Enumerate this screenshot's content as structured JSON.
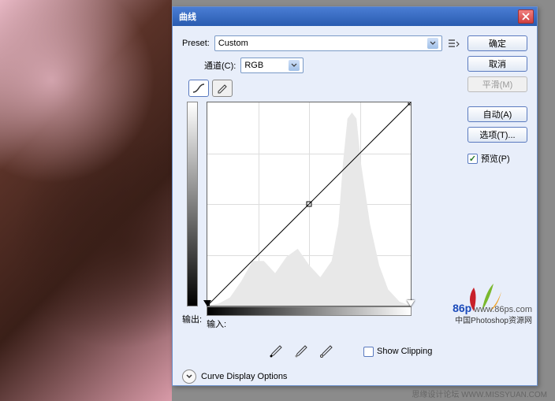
{
  "dialog": {
    "title": "曲线",
    "preset_label": "Preset:",
    "preset_value": "Custom",
    "channel_label": "通道(C):",
    "channel_value": "RGB",
    "output_label": "输出:",
    "input_label": "输入:",
    "show_clipping_label": "Show Clipping",
    "curve_display_label": "Curve Display Options"
  },
  "buttons": {
    "ok": "确定",
    "cancel": "取消",
    "smooth": "平滑(M)",
    "auto": "自动(A)",
    "options": "选项(T)..."
  },
  "preview": {
    "label": "预览(P)",
    "checked": true
  },
  "chart_data": {
    "type": "line",
    "title": "Curves",
    "xlabel": "输入",
    "ylabel": "输出",
    "xlim": [
      0,
      255
    ],
    "ylim": [
      0,
      255
    ],
    "channel": "RGB",
    "points": [
      {
        "x": 0,
        "y": 0
      },
      {
        "x": 128,
        "y": 128
      },
      {
        "x": 255,
        "y": 255
      }
    ],
    "histogram_approx": [
      0,
      0,
      0,
      0,
      0,
      1,
      2,
      2,
      3,
      4,
      5,
      6,
      8,
      10,
      12,
      14,
      16,
      18,
      20,
      22,
      22,
      22,
      22,
      20,
      18,
      16,
      14,
      14,
      14,
      16,
      18,
      20,
      22,
      24,
      26,
      28,
      28,
      28,
      26,
      24,
      22,
      20,
      18,
      16,
      14,
      12,
      10,
      10,
      10,
      12,
      14,
      16,
      18,
      20,
      22,
      24,
      26,
      30,
      36,
      44,
      54,
      66,
      80,
      92,
      96,
      92,
      80,
      66,
      54,
      44,
      36,
      30,
      26,
      22,
      18,
      14,
      10,
      6,
      4,
      2,
      1,
      0,
      0,
      0,
      0,
      0,
      0,
      0,
      0,
      0
    ]
  },
  "watermark": {
    "logo_text": "86p",
    "url": "www.86ps.com",
    "site_name": "中国Photoshop资源网"
  },
  "footer": {
    "text": "思缘设计论坛   WWW.MISSYUAN.COM"
  }
}
